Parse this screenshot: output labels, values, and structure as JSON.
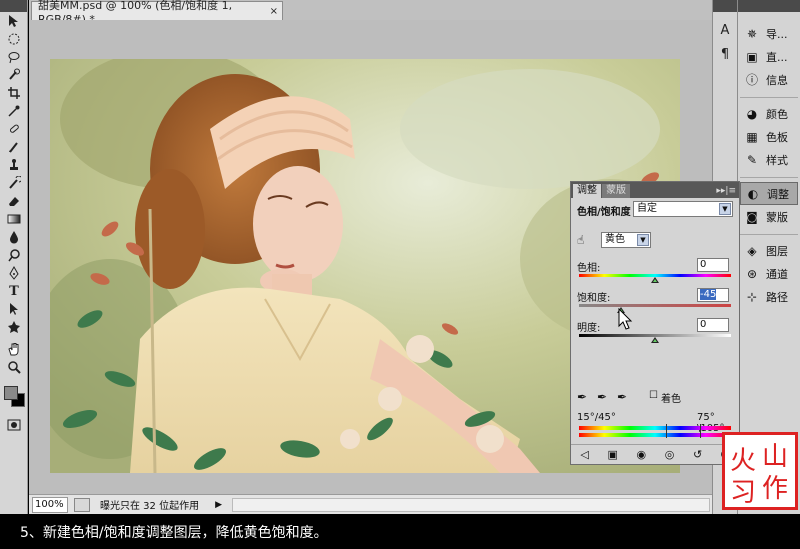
{
  "document": {
    "tab_title": "甜美MM.psd @ 100% (色相/饱和度 1, RGB/8#) *",
    "close_symbol": "×"
  },
  "status_bar": {
    "zoom": "100%",
    "message": "曝光只在 32 位起作用",
    "arrow": "▶"
  },
  "toolbar": {
    "type_tool_glyph": "T"
  },
  "dock_narrow": {
    "items": [
      {
        "name": "character",
        "glyph": "A"
      },
      {
        "name": "paragraph",
        "glyph": "¶"
      }
    ]
  },
  "dock": {
    "group1": [
      {
        "label": "导...",
        "icon": "navigator-icon"
      },
      {
        "label": "直...",
        "icon": "histogram-icon"
      },
      {
        "label": "信息",
        "icon": "info-icon"
      }
    ],
    "group2": [
      {
        "label": "颜色",
        "icon": "color-icon"
      },
      {
        "label": "色板",
        "icon": "swatches-icon"
      },
      {
        "label": "样式",
        "icon": "styles-icon"
      }
    ],
    "group3": [
      {
        "label": "调整",
        "icon": "adjustments-icon"
      },
      {
        "label": "蒙版",
        "icon": "masks-icon"
      }
    ],
    "group4": [
      {
        "label": "图层",
        "icon": "layers-icon"
      },
      {
        "label": "通道",
        "icon": "channels-icon"
      },
      {
        "label": "路径",
        "icon": "paths-icon"
      }
    ]
  },
  "adjustments_panel": {
    "tabs": [
      "调整",
      "蒙版"
    ],
    "active_tab": "调整",
    "panel_controls": "▸▸|≡",
    "title": "色相/饱和度",
    "preset": "自定",
    "channel": "黄色",
    "hue_label": "色相:",
    "hue_value": "0",
    "hue_fraction": 0.5,
    "saturation_label": "饱和度:",
    "saturation_value": "-45",
    "saturation_fraction": 0.275,
    "lightness_label": "明度:",
    "lightness_value": "0",
    "lightness_fraction": 0.5,
    "colorize_label": "着色",
    "range_left": "15°/45°",
    "range_right": "75°\\105°"
  },
  "logo": {
    "chars": [
      "山",
      "作",
      "火",
      "习"
    ]
  },
  "caption": "5、新建色相/饱和度调整图层，降低黄色饱和度。"
}
